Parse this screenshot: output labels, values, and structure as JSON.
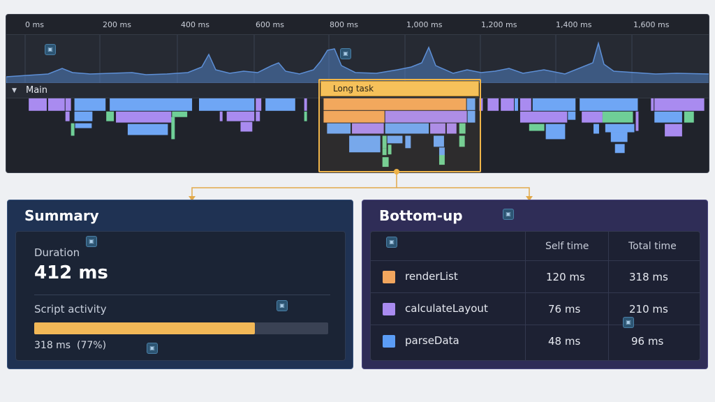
{
  "timeline": {
    "ticks": [
      "0 ms",
      "200 ms",
      "400 ms",
      "600 ms",
      "800 ms",
      "1,000 ms",
      "1,200 ms",
      "1,400 ms",
      "1,600 ms"
    ],
    "track_name": "Main",
    "long_task_label": "Long task",
    "colors": {
      "scripting": "#f2b36b",
      "rendering": "#a98bf0",
      "painting": "#6fa6f5",
      "other": "#6fcf97",
      "highlight": "#f0b54a"
    }
  },
  "summary": {
    "title": "Summary",
    "duration_label": "Duration",
    "duration_value": "412 ms",
    "activity_label": "Script activity",
    "activity_fraction": 0.75,
    "activity_value": "318 ms  (77%)"
  },
  "bottom_up": {
    "title": "Bottom-up",
    "columns": [
      "",
      "Self time",
      "Total time"
    ],
    "rows": [
      {
        "name": "renderList",
        "self": "120 ms",
        "total": "318 ms",
        "color": "#f2a65e"
      },
      {
        "name": "calculateLayout",
        "self": "76 ms",
        "total": "210 ms",
        "color": "#a98bf0"
      },
      {
        "name": "parseData",
        "self": "48 ms",
        "total": "96 ms",
        "color": "#5b9cf5"
      }
    ]
  }
}
